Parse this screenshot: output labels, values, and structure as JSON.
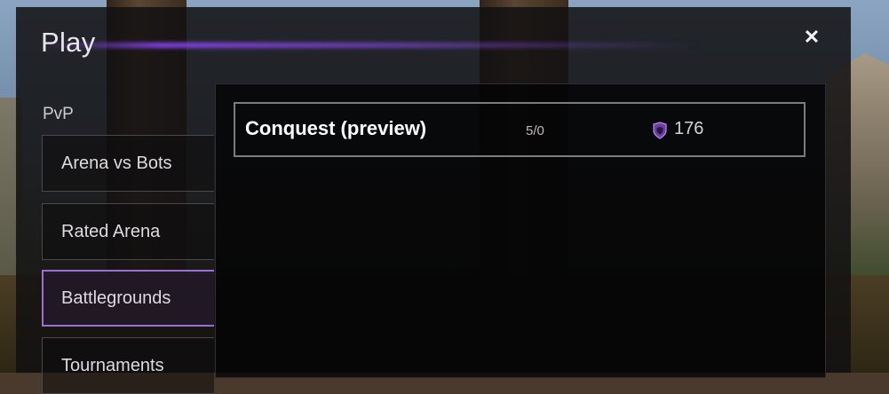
{
  "dialog": {
    "title": "Play",
    "close_label": "✕"
  },
  "sidebar": {
    "category": "PvP",
    "items": [
      {
        "label": "Arena vs Bots",
        "selected": false
      },
      {
        "label": "Rated Arena",
        "selected": false
      },
      {
        "label": "Battlegrounds",
        "selected": true
      },
      {
        "label": "Tournaments",
        "selected": false
      }
    ]
  },
  "queues": [
    {
      "name": "Conquest (preview)",
      "ratio": "5/0",
      "points_icon": "shield-icon",
      "points": "176"
    }
  ],
  "colors": {
    "accent": "#9b6fd0",
    "title_glow": "#9146ff"
  }
}
